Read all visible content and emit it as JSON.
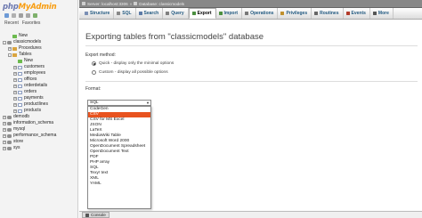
{
  "sidebar": {
    "logo_part1": "php",
    "logo_part2": "MyAdmin",
    "recent_label": "Recent",
    "favorites_label": "Favorites",
    "tree": [
      {
        "label": "New",
        "indent": 1,
        "icon": "new",
        "expander": ""
      },
      {
        "label": "classicmodels",
        "indent": 0,
        "icon": "db",
        "expander": "-"
      },
      {
        "label": "Procedures",
        "indent": 1,
        "icon": "grp",
        "expander": "+"
      },
      {
        "label": "Tables",
        "indent": 1,
        "icon": "grp",
        "expander": "-"
      },
      {
        "label": "New",
        "indent": 2,
        "icon": "new",
        "expander": ""
      },
      {
        "label": "customers",
        "indent": 2,
        "icon": "tbl",
        "expander": "+"
      },
      {
        "label": "employees",
        "indent": 2,
        "icon": "tbl",
        "expander": "+"
      },
      {
        "label": "offices",
        "indent": 2,
        "icon": "tbl",
        "expander": "+"
      },
      {
        "label": "orderdetails",
        "indent": 2,
        "icon": "tbl",
        "expander": "+"
      },
      {
        "label": "orders",
        "indent": 2,
        "icon": "tbl",
        "expander": "+"
      },
      {
        "label": "payments",
        "indent": 2,
        "icon": "tbl",
        "expander": "+"
      },
      {
        "label": "productlines",
        "indent": 2,
        "icon": "tbl",
        "expander": "+"
      },
      {
        "label": "products",
        "indent": 2,
        "icon": "tbl",
        "expander": "+"
      },
      {
        "label": "demodb",
        "indent": 0,
        "icon": "db",
        "expander": "+"
      },
      {
        "label": "information_schema",
        "indent": 0,
        "icon": "db",
        "expander": "+"
      },
      {
        "label": "mysql",
        "indent": 0,
        "icon": "db",
        "expander": "+"
      },
      {
        "label": "performance_schema",
        "indent": 0,
        "icon": "db",
        "expander": "+"
      },
      {
        "label": "store",
        "indent": 0,
        "icon": "db",
        "expander": "+"
      },
      {
        "label": "sys",
        "indent": 0,
        "icon": "db",
        "expander": "+"
      }
    ]
  },
  "topbar": {
    "server": "Server: localhost:3306",
    "separator": "»",
    "database": "Database: classicmodels"
  },
  "tabs": [
    {
      "label": "Structure",
      "icon": "table-icon",
      "color": "#7a8fb4"
    },
    {
      "label": "SQL",
      "icon": "sql-icon",
      "color": "#888888"
    },
    {
      "label": "Search",
      "icon": "search-icon",
      "color": "#5c7aa6"
    },
    {
      "label": "Query",
      "icon": "query-icon",
      "color": "#7f7f7f"
    },
    {
      "label": "Export",
      "icon": "export-icon",
      "color": "#4b8f3f",
      "active": true
    },
    {
      "label": "Import",
      "icon": "import-icon",
      "color": "#4b8f3f"
    },
    {
      "label": "Operations",
      "icon": "wrench-icon",
      "color": "#777777"
    },
    {
      "label": "Privileges",
      "icon": "users-icon",
      "color": "#c0902c"
    },
    {
      "label": "Routines",
      "icon": "routines-icon",
      "color": "#666666"
    },
    {
      "label": "Events",
      "icon": "clock-icon",
      "color": "#b23b2a"
    },
    {
      "label": "More",
      "icon": "chevron-down-icon",
      "color": "#555555"
    }
  ],
  "main": {
    "title": "Exporting tables from \"classicmodels\" database",
    "export_method_label": "Export method:",
    "method_quick": "Quick - display only the minimal options",
    "method_custom": "Custom - display all possible options",
    "format_label": "Format:",
    "selected_format": "SQL",
    "format_options": [
      "CodeGen",
      "CSV",
      "CSV for MS Excel",
      "JSON",
      "LaTeX",
      "MediaWiki Table",
      "Microsoft Word 2000",
      "OpenDocument Spreadsheet",
      "OpenDocument Text",
      "PDF",
      "PHP array",
      "SQL",
      "Texy! text",
      "XML",
      "YAML"
    ],
    "highlighted_option": "CSV"
  },
  "console": {
    "label": "Console"
  },
  "colors": {
    "logo_blue": "#6c78af",
    "logo_orange": "#f89c0e",
    "highlight": "#e8531f",
    "tab_link": "#235a81"
  }
}
